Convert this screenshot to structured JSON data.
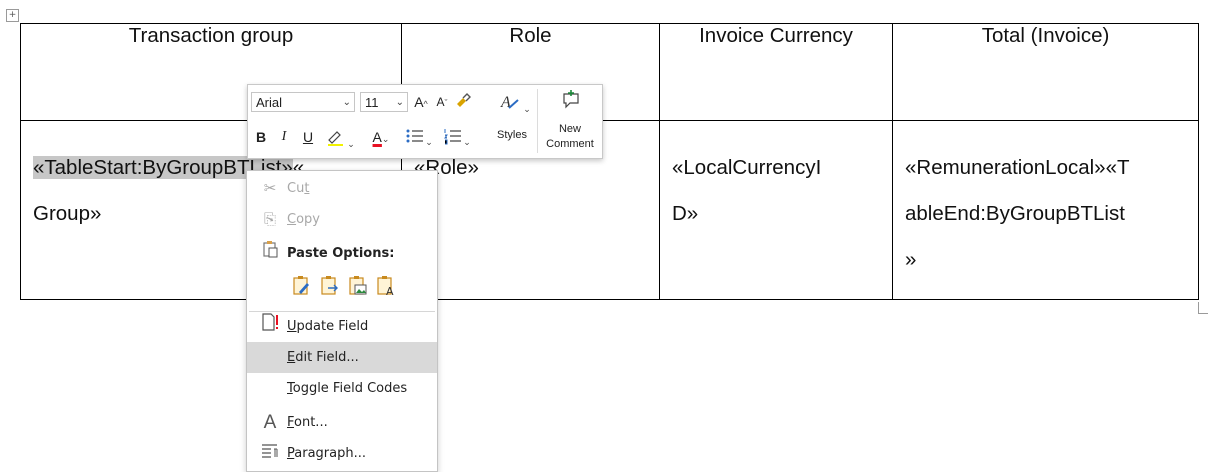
{
  "table": {
    "headers": [
      "Transaction group",
      "Role",
      "Invoice Currency",
      "Total (Invoice)"
    ],
    "body": {
      "col1_selected": "«TableStart:ByGroupBTList»",
      "col1_rest_a": "«",
      "col1_rest_b": "Group»",
      "col2": "«Role»",
      "col3_line1": "«LocalCurrencyI",
      "col3_line2": "D»",
      "col4_line1": "«RemunerationLocal»«T",
      "col4_line2": "ableEnd:ByGroupBTList",
      "col4_line3": "»"
    }
  },
  "mini_toolbar": {
    "font_name": "Arial",
    "font_size": "11",
    "grow_font": "A",
    "shrink_font": "A",
    "bold": "B",
    "italic": "I",
    "underline": "U",
    "font_color_letter": "A",
    "styles_label": "Styles",
    "new_comment_label_1": "New",
    "new_comment_label_2": "Comment",
    "font_color_hex": "#e81123"
  },
  "context_menu": {
    "cut": "Cut",
    "copy": "Copy",
    "paste_options": "Paste Options:",
    "update_field": "Update Field",
    "edit_field": "Edit Field...",
    "toggle_field_codes": "Toggle Field Codes",
    "font": "Font...",
    "paragraph": "Paragraph..."
  }
}
